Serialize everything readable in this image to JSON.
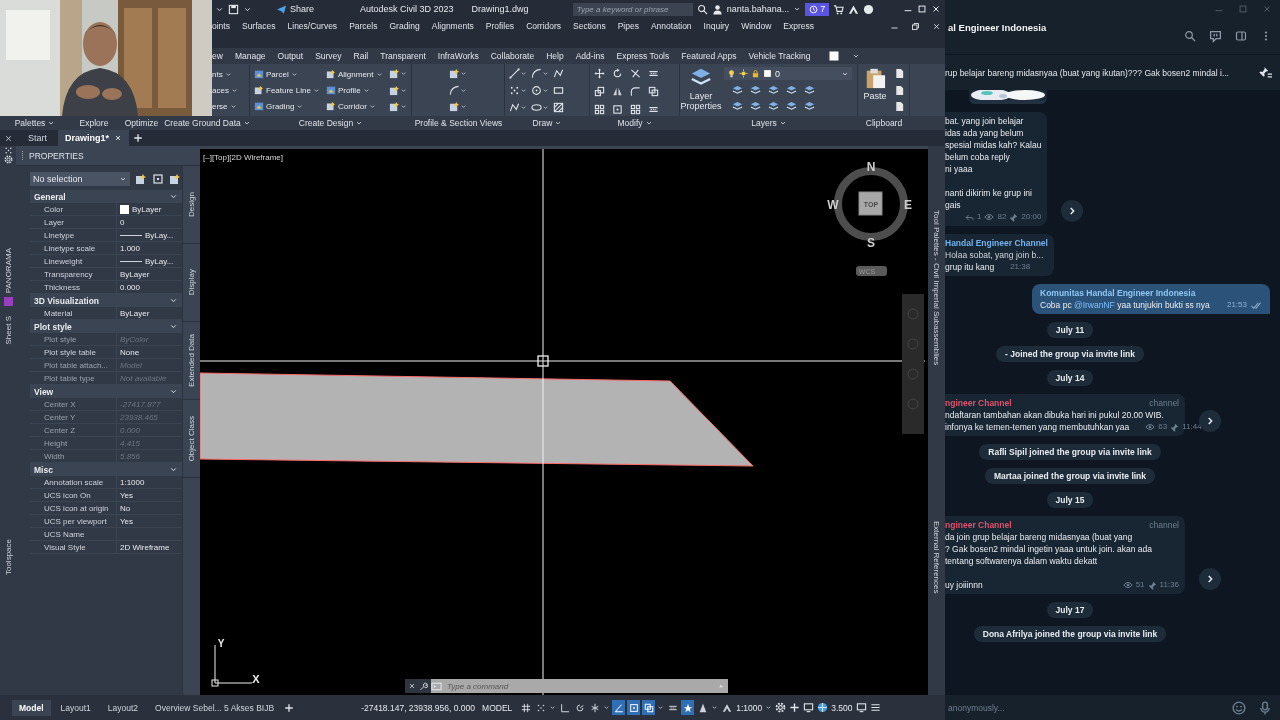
{
  "titlebar": {
    "share": "Share",
    "app": "Autodesk Civil 3D 2023",
    "file": "Drawing1.dwg",
    "search_placeholder": "Type a keyword or phrase",
    "user": "nanta.bahana...",
    "notifications": "7"
  },
  "menu": [
    "oints",
    "Surfaces",
    "Lines/Curves",
    "Parcels",
    "Grading",
    "Alignments",
    "Profiles",
    "Corridors",
    "Sections",
    "Pipes",
    "Annotation",
    "Inquiry",
    "Window",
    "Express"
  ],
  "ribbon": {
    "tabs": [
      "ew",
      "Manage",
      "Output",
      "Survey",
      "Rail",
      "Transparent",
      "InfraWorks",
      "Collaborate",
      "Help",
      "Add-ins",
      "Express Tools",
      "Featured Apps",
      "Vehicle Tracking"
    ],
    "groups": [
      {
        "kind": "text_buttons",
        "items": [
          {
            "label": "nts",
            "dropdown": true
          },
          {
            "label": "aces",
            "dropdown": true
          },
          {
            "label": "erse",
            "dropdown": true
          }
        ]
      },
      {
        "kind": "create_design",
        "items": [
          {
            "label": "Parcel",
            "dropdown": true
          },
          {
            "label": "Feature Line",
            "dropdown": true
          },
          {
            "label": "Grading",
            "dropdown": true
          },
          {
            "label": "Alignment",
            "dropdown": true
          },
          {
            "label": "Profile",
            "dropdown": true
          },
          {
            "label": "Corridor",
            "dropdown": true
          }
        ]
      },
      {
        "kind": "profile_views"
      },
      {
        "kind": "draw"
      },
      {
        "kind": "modify"
      },
      {
        "kind": "layers",
        "button": "Layer Properties",
        "layer": "0"
      },
      {
        "kind": "clipboard",
        "button": "Paste"
      }
    ],
    "panel_titles": [
      {
        "title": "Palettes",
        "dropdown": true
      },
      {
        "title": "Explore",
        "dropdown": false
      },
      {
        "title": "Optimize",
        "dropdown": false
      },
      {
        "title": "Create Ground Data",
        "dropdown": true
      },
      {
        "title": "Create Design",
        "dropdown": true
      },
      {
        "title": "Profile & Section Views",
        "dropdown": false
      },
      {
        "title": "Draw",
        "dropdown": true
      },
      {
        "title": "Modify",
        "dropdown": true
      },
      {
        "title": "Layers",
        "dropdown": true
      },
      {
        "title": "Clipboard",
        "dropdown": false
      }
    ]
  },
  "file_tabs": [
    {
      "label": "Start",
      "selected": false,
      "closable": false
    },
    {
      "label": "Drawing1*",
      "selected": true,
      "closable": true
    }
  ],
  "left_strip": {
    "labels": [
      "PANORAMA",
      "Sheet S",
      "Toolspace"
    ]
  },
  "properties": {
    "title": "PROPERTIES",
    "selection": "No selection",
    "sections": [
      {
        "title": "General",
        "expanded": true,
        "rows": [
          {
            "name": "Color",
            "value": "ByLayer",
            "kind": "swatch",
            "disabled": false
          },
          {
            "name": "Layer",
            "value": "0",
            "kind": "text",
            "disabled": false
          },
          {
            "name": "Linetype",
            "value": "ByLay...",
            "kind": "line",
            "disabled": false
          },
          {
            "name": "Linetype scale",
            "value": "1.000",
            "kind": "text",
            "disabled": false
          },
          {
            "name": "Lineweight",
            "value": "ByLay...",
            "kind": "line",
            "disabled": false
          },
          {
            "name": "Transparency",
            "value": "ByLayer",
            "kind": "text",
            "disabled": false
          },
          {
            "name": "Thickness",
            "value": "0.000",
            "kind": "text",
            "disabled": false
          }
        ]
      },
      {
        "title": "3D Visualization",
        "expanded": true,
        "rows": [
          {
            "name": "Material",
            "value": "ByLayer",
            "kind": "text",
            "disabled": false
          }
        ]
      },
      {
        "title": "Plot style",
        "expanded": true,
        "rows": [
          {
            "name": "Plot style",
            "value": "ByColor",
            "kind": "text",
            "disabled": true
          },
          {
            "name": "Plot style table",
            "value": "None",
            "kind": "text",
            "disabled": false
          },
          {
            "name": "Plot table attach...",
            "value": "Model",
            "kind": "text",
            "disabled": true
          },
          {
            "name": "Plot table type",
            "value": "Not available",
            "kind": "text",
            "disabled": true
          }
        ]
      },
      {
        "title": "View",
        "expanded": true,
        "rows": [
          {
            "name": "Center X",
            "value": "-27417.877",
            "kind": "text",
            "disabled": true
          },
          {
            "name": "Center Y",
            "value": "23938.465",
            "kind": "text",
            "disabled": true
          },
          {
            "name": "Center Z",
            "value": "0.000",
            "kind": "text",
            "disabled": true
          },
          {
            "name": "Height",
            "value": "4.415",
            "kind": "text",
            "disabled": true
          },
          {
            "name": "Width",
            "value": "5.856",
            "kind": "text",
            "disabled": true
          }
        ]
      },
      {
        "title": "Misc",
        "expanded": true,
        "rows": [
          {
            "name": "Annotation scale",
            "value": "1:1000",
            "kind": "text",
            "disabled": false
          },
          {
            "name": "UCS icon On",
            "value": "Yes",
            "kind": "text",
            "disabled": false
          },
          {
            "name": "UCS icon at origin",
            "value": "No",
            "kind": "text",
            "disabled": false
          },
          {
            "name": "UCS per viewport",
            "value": "Yes",
            "kind": "text",
            "disabled": false
          },
          {
            "name": "UCS Name",
            "kind": "text",
            "disabled": false
          },
          {
            "name": "Visual Style",
            "value": "2D Wireframe",
            "kind": "text",
            "disabled": false
          }
        ]
      }
    ],
    "side_tabs": [
      "Design",
      "Display",
      "Extended Data",
      "Object Class"
    ]
  },
  "viewport": {
    "label": "[–][Top][2D Wireframe]",
    "compass": {
      "north": "N",
      "south": "S",
      "east": "E",
      "west": "W",
      "face": "TOP"
    },
    "wcs": "WCS",
    "ucs": {
      "x": "X",
      "y": "Y"
    },
    "command_placeholder": "Type a command"
  },
  "right_strip": {
    "labels": [
      "Tool Palettes - Civil Imperial Subassemblies",
      "External References"
    ]
  },
  "status_bar": {
    "layout_tabs": [
      {
        "label": "Model",
        "selected": true
      },
      {
        "label": "Layout1",
        "selected": false
      },
      {
        "label": "Layout2",
        "selected": false
      },
      {
        "label": "Overview Sebel... 5 Akses BIJB",
        "selected": false
      }
    ],
    "coordinates": "-27418.147, 23938.956, 0.000",
    "space": "MODEL",
    "toggles": [
      {
        "on": false
      },
      {
        "on": false
      },
      {
        "on": false
      },
      {
        "on": false
      },
      {
        "on": false
      },
      {
        "on": true
      },
      {
        "on": true
      },
      {
        "on": true
      },
      {
        "on": false
      },
      {
        "on": true
      },
      {
        "on": false
      },
      {
        "on": false
      }
    ],
    "scale": "1:1000",
    "value": "3.500"
  },
  "telegram": {
    "title": "al Engineer Indonesia",
    "pinned": "rup belajar bareng midasnyaa (buat yang ikutan)??? Gak bosen2 mindal i...",
    "messages": [
      {
        "kind": "picture"
      },
      {
        "kind": "post",
        "paragraphs": [
          [
            "bat. yang join belajar",
            "idas ada yang belum",
            "spesial midas kah? Kalau",
            "belum coba reply",
            "ni yaaa"
          ],
          [
            "nanti dikirim ke grup ini",
            "gais"
          ]
        ],
        "replies": "1",
        "views": "82",
        "time": "20:00"
      },
      {
        "kind": "reply",
        "quote_name": "Handal Engineer Channel",
        "quote_text": "Holaa sobat, yang join b...",
        "text": "grup itu kang",
        "time": "21:38"
      },
      {
        "kind": "outgoing",
        "sender": "Komunitas Handal Engineer Indonesia",
        "segments": [
          {
            "text": "Coba pc",
            "kind": "plain"
          },
          {
            "text": "@IrwanNF",
            "kind": "mention"
          },
          {
            "text": "yaa tunjukin bukti ss nya",
            "kind": "plain"
          }
        ],
        "time": "21:53"
      },
      {
        "kind": "date",
        "text": "July 11"
      },
      {
        "kind": "service",
        "text": "- Joined the group via invite link"
      },
      {
        "kind": "date",
        "text": "July 14"
      },
      {
        "kind": "channel_post",
        "author": "ngineer Channel",
        "badge": "channel",
        "paragraphs": [
          [
            "ndaftaran tambahan akan dibuka hari ini pukul 20.00 WIB.",
            "infonya ke temen-temen yang membutuhkan yaa"
          ]
        ],
        "views": "63",
        "time": "11:44"
      },
      {
        "kind": "service",
        "text": "Rafli Sipil joined the group via invite link"
      },
      {
        "kind": "service",
        "text": "Martaa joined the group via invite link"
      },
      {
        "kind": "date",
        "text": "July 15"
      },
      {
        "kind": "channel_post",
        "author": "ngineer Channel",
        "badge": "channel",
        "paragraphs": [
          [
            "da join grup belajar bareng midasnyaa (buat yang",
            "? Gak bosen2 mindal ingetin yaaa untuk join. akan ada",
            "tentang softwarenya dalam waktu dekatt"
          ],
          [
            "uy joiiinnn"
          ]
        ],
        "views": "51",
        "time": "11:36"
      },
      {
        "kind": "date",
        "text": "July 17"
      },
      {
        "kind": "service",
        "text": "Dona Afrilya joined the group via invite link"
      }
    ],
    "input_placeholder": "anonymously..."
  }
}
